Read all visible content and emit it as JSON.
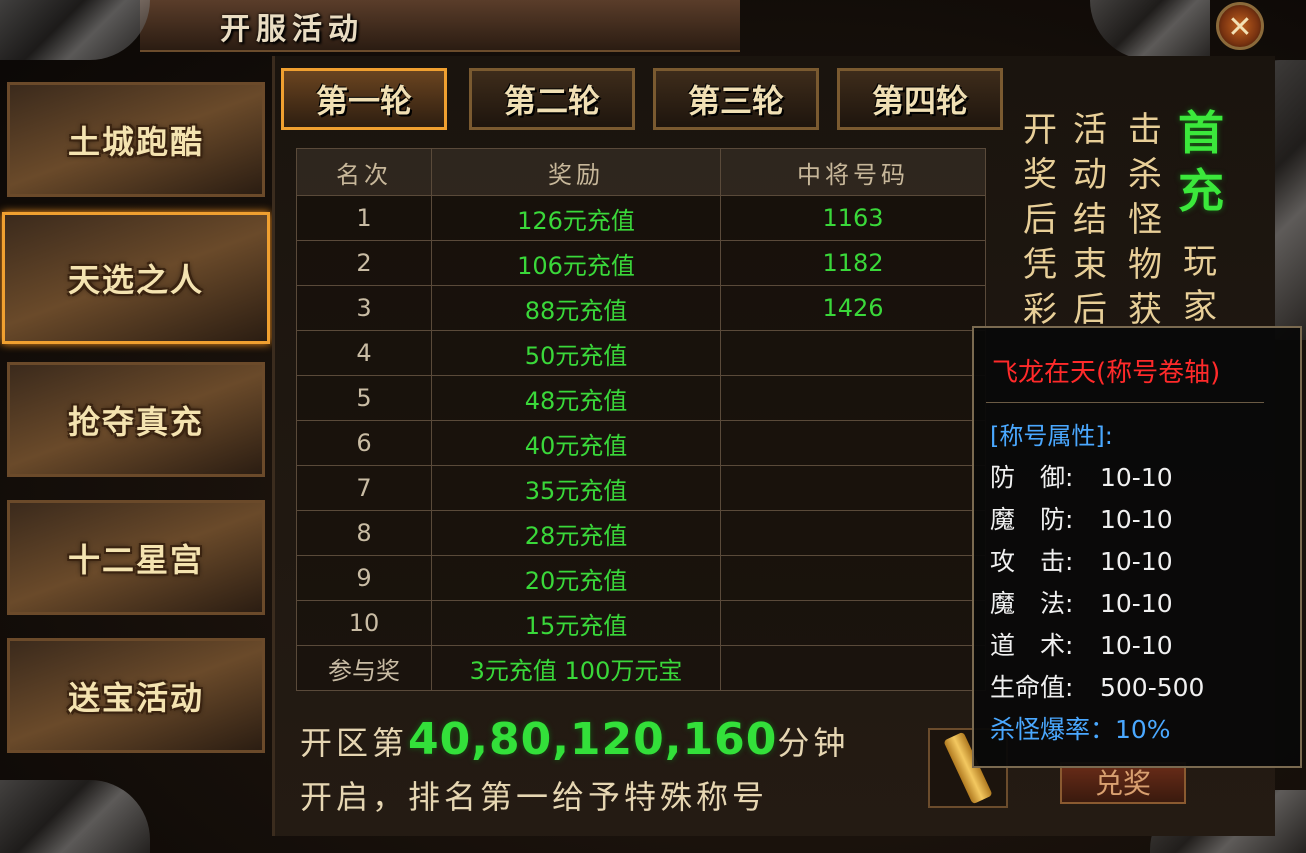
{
  "window": {
    "title": "开服活动",
    "close_label": "✕"
  },
  "sidebar": {
    "items": [
      {
        "label": "土城跑酷",
        "active": false
      },
      {
        "label": "天选之人",
        "active": true
      },
      {
        "label": "抢夺真充",
        "active": false
      },
      {
        "label": "十二星宫",
        "active": false
      },
      {
        "label": "送宝活动",
        "active": false
      }
    ]
  },
  "tabs": [
    {
      "label": "第一轮",
      "active": true
    },
    {
      "label": "第二轮",
      "active": false
    },
    {
      "label": "第三轮",
      "active": false
    },
    {
      "label": "第四轮",
      "active": false
    }
  ],
  "table": {
    "headers": [
      "名次",
      "奖励",
      "中将号码"
    ],
    "rows": [
      {
        "rank": "1",
        "reward": "126元充值",
        "code": "1163"
      },
      {
        "rank": "2",
        "reward": "106元充值",
        "code": "1182"
      },
      {
        "rank": "3",
        "reward": "88元充值",
        "code": "1426"
      },
      {
        "rank": "4",
        "reward": "50元充值",
        "code": ""
      },
      {
        "rank": "5",
        "reward": "48元充值",
        "code": ""
      },
      {
        "rank": "6",
        "reward": "40元充值",
        "code": ""
      },
      {
        "rank": "7",
        "reward": "35元充值",
        "code": ""
      },
      {
        "rank": "8",
        "reward": "28元充值",
        "code": ""
      },
      {
        "rank": "9",
        "reward": "20元充值",
        "code": ""
      },
      {
        "rank": "10",
        "reward": "15元充值",
        "code": ""
      },
      {
        "rank": "参与奖",
        "reward": "3元充值 100万元宝",
        "code": ""
      }
    ]
  },
  "footer": {
    "line1_prefix": "开区第",
    "line1_numbers": "40,80,120,160",
    "line1_suffix": "分钟",
    "line2": "开启，排名第一给予特殊称号"
  },
  "side_text": {
    "col1": "开奖后凭彩",
    "col2": "活动结束后",
    "col3": "击杀怪物获",
    "col4_green": "首充",
    "col4": "玩家"
  },
  "claim_button": {
    "label": "兑奖"
  },
  "tooltip": {
    "title": "飞龙在天(称号卷轴)",
    "section": "[称号属性]:",
    "stats": [
      {
        "key": "防　御:",
        "value": "10-10"
      },
      {
        "key": "魔　防:",
        "value": "10-10"
      },
      {
        "key": "攻　击:",
        "value": "10-10"
      },
      {
        "key": "魔　法:",
        "value": "10-10"
      },
      {
        "key": "道　术:",
        "value": "10-10"
      },
      {
        "key": "生命值:",
        "value": "500-500"
      }
    ],
    "kill_rate": "杀怪爆率：10%"
  },
  "colors": {
    "accent": "#f0a030",
    "reward_green": "#3ad83a",
    "tooltip_title": "#ff2a2a",
    "tooltip_blue": "#4aa8ff"
  }
}
